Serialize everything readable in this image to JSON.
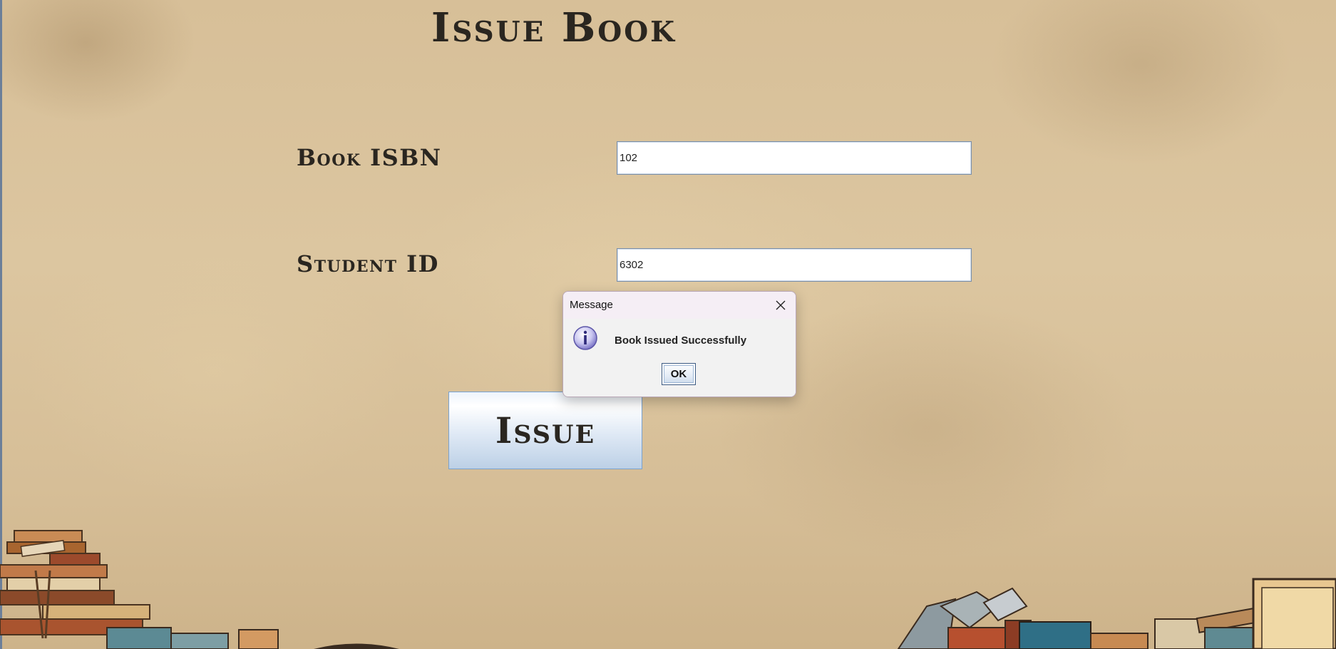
{
  "page": {
    "title": "Issue Book"
  },
  "form": {
    "isbn_label": "Book ISBN",
    "isbn_value": "102",
    "student_label": "Student ID",
    "student_value": "6302",
    "issue_button_label": "Issue"
  },
  "dialog": {
    "title": "Message",
    "message": "Book Issued Successfully",
    "ok_label": "OK",
    "icon": "info-icon",
    "close_icon": "close-icon"
  },
  "colors": {
    "background": "#d7bf98",
    "text": "#2a2620",
    "button_gradient_bottom": "#bcd0e6",
    "dialog_titlebar": "#f5eef5"
  }
}
